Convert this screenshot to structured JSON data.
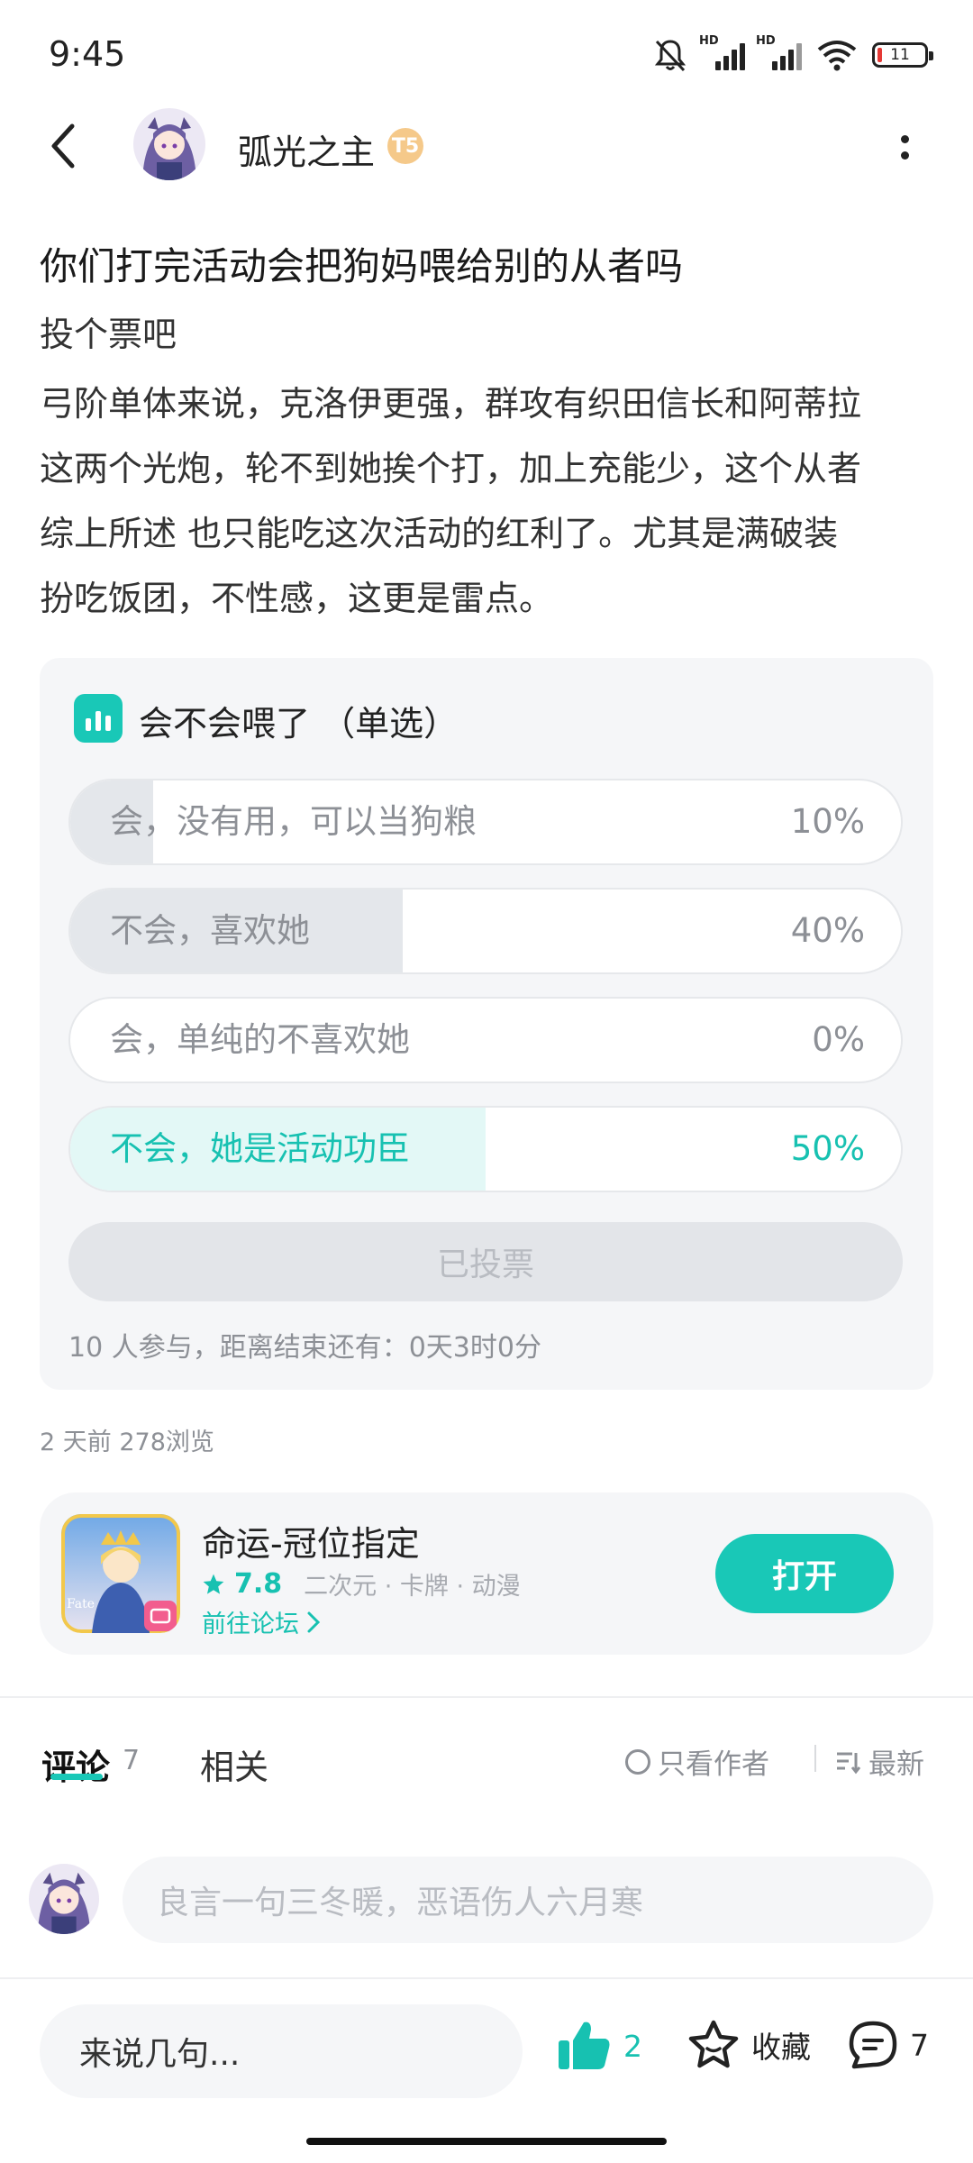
{
  "status_bar": {
    "time": "9:45",
    "signal_label": "HD",
    "battery": "11"
  },
  "header": {
    "author_name": "弧光之主",
    "level_badge": "T5"
  },
  "post": {
    "title": "你们打完活动会把狗妈喂给别的从者吗",
    "subtitle": "投个票吧",
    "body_lines": [
      "弓阶单体来说，克洛伊更强，群攻有织田信长和阿蒂拉",
      "这两个光炮，轮不到她挨个打，加上充能少，这个从者",
      "综上所述 也只能吃这次活动的红利了。尤其是满破装",
      "扮吃饭团，不性感，这更是雷点。"
    ]
  },
  "poll": {
    "title": "会不会喂了 （单选）",
    "options": [
      {
        "label": "会，没有用，可以当狗粮",
        "percent_text": "10%",
        "fraction": 0.1,
        "selected": false
      },
      {
        "label": "不会，喜欢她",
        "percent_text": "40%",
        "fraction": 0.4,
        "selected": false
      },
      {
        "label": "会，单纯的不喜欢她",
        "percent_text": "0%",
        "fraction": 0.0,
        "selected": false
      },
      {
        "label": "不会，她是活动功臣",
        "percent_text": "50%",
        "fraction": 0.5,
        "selected": true
      }
    ],
    "voted_label": "已投票",
    "footer": "10 人参与，距离结束还有：0天3时0分"
  },
  "meta": "2 天前  278浏览",
  "game": {
    "name": "命运-冠位指定",
    "score": "7.8",
    "tags": "二次元 · 卡牌 · 动漫",
    "forum_link": "前往论坛",
    "open_label": "打开",
    "accent_color": "#19c8b7"
  },
  "comments": {
    "tab_label": "评论",
    "count": "7",
    "related_label": "相关",
    "author_only_label": "只看作者",
    "sort_label": "最新",
    "input_placeholder": "良言一句三冬暖，恶语伤人六月寒"
  },
  "bottom_bar": {
    "input_label": "来说几句...",
    "like_count": "2",
    "favorite_label": "收藏",
    "comment_count": "7"
  }
}
